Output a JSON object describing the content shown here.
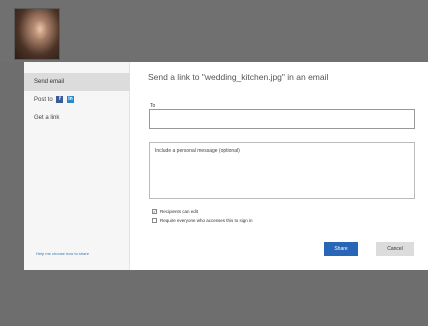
{
  "sidebar": {
    "items": [
      {
        "label": "Send email"
      },
      {
        "label": "Post to"
      },
      {
        "label": "Get a link"
      }
    ],
    "help_link": "Help me choose how to share"
  },
  "dialog": {
    "heading": "Send a link to \"wedding_kitchen.jpg\" in an email",
    "to_label": "To",
    "to_value": "",
    "message_placeholder": "Include a personal message (optional)",
    "options": [
      {
        "label": "Recipients can edit",
        "checked": true
      },
      {
        "label": "Require everyone who accesses this to sign in",
        "checked": false
      }
    ],
    "share_label": "Share",
    "cancel_label": "Cancel"
  },
  "icons": {
    "facebook": "facebook-icon",
    "linkedin": "linkedin-icon"
  },
  "colors": {
    "accent": "#2a66b8",
    "facebook": "#3b5a9a",
    "linkedin": "#2b88c8"
  }
}
